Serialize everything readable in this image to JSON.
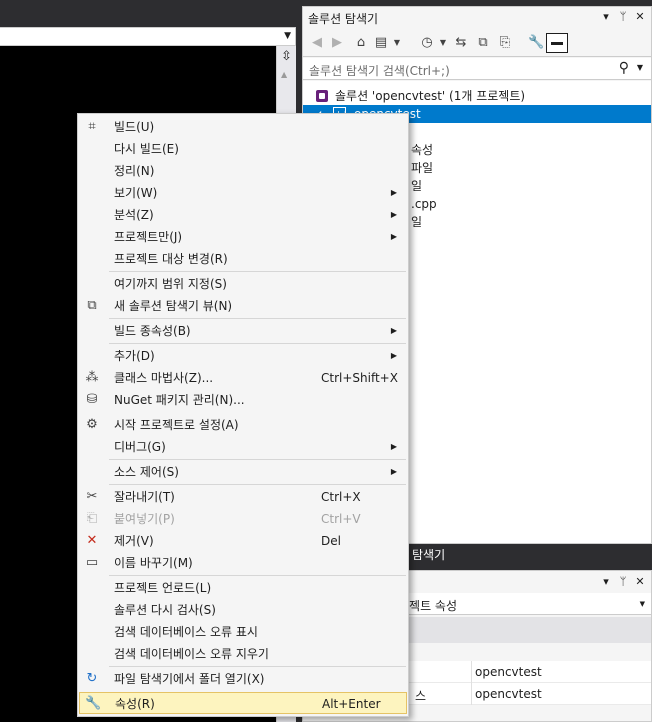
{
  "solution_explorer": {
    "title": "솔루션 탐색기",
    "title_buttons": {
      "dropdown": "▾",
      "pin": "ᛘ",
      "close": "✕"
    },
    "search_placeholder": "솔루션 탐색기 검색(Ctrl+;)",
    "tree": [
      {
        "label": "솔루션 'opencvtest' (1개 프로젝트)"
      },
      {
        "label": "opencvtest",
        "selected": true
      },
      {
        "label": "속성"
      },
      {
        "label": "파일"
      },
      {
        "label": "일"
      },
      {
        "label": ".cpp"
      },
      {
        "label": "일"
      }
    ],
    "bottom_tab": "탐색기"
  },
  "properties": {
    "title_buttons": {
      "dropdown": "▾",
      "pin": "ᛘ",
      "close": "✕"
    },
    "dropdown_value": "로젝트 속성",
    "rows": [
      {
        "name": "",
        "value": "opencvtest"
      },
      {
        "name": "스",
        "value": "opencvtest"
      }
    ]
  },
  "context_menu": {
    "items": [
      {
        "label": "빌드(U)",
        "icon": "build-icon"
      },
      {
        "label": "다시 빌드(E)"
      },
      {
        "label": "정리(N)"
      },
      {
        "label": "보기(W)",
        "submenu": true
      },
      {
        "label": "분석(Z)",
        "submenu": true
      },
      {
        "label": "프로젝트만(J)",
        "submenu": true
      },
      {
        "label": "프로젝트 대상 변경(R)"
      },
      {
        "label": "여기까지 범위 지정(S)"
      },
      {
        "label": "새 솔루션 탐색기 뷰(N)",
        "icon": "new-view-icon"
      },
      {
        "label": "빌드 종속성(B)",
        "submenu": true
      },
      {
        "label": "추가(D)",
        "submenu": true
      },
      {
        "label": "클래스 마법사(Z)...",
        "shortcut": "Ctrl+Shift+X",
        "icon": "class-wizard-icon"
      },
      {
        "label": "NuGet 패키지 관리(N)...",
        "icon": "nuget-icon"
      },
      {
        "label": "시작 프로젝트로 설정(A)",
        "icon": "gear-icon"
      },
      {
        "label": "디버그(G)",
        "submenu": true
      },
      {
        "label": "소스 제어(S)",
        "submenu": true
      },
      {
        "label": "잘라내기(T)",
        "shortcut": "Ctrl+X",
        "icon": "scissors-icon"
      },
      {
        "label": "붙여넣기(P)",
        "shortcut": "Ctrl+V",
        "icon": "paste-icon",
        "disabled": true
      },
      {
        "label": "제거(V)",
        "shortcut": "Del",
        "icon": "delete-icon"
      },
      {
        "label": "이름 바꾸기(M)",
        "icon": "rename-icon"
      },
      {
        "label": "프로젝트 언로드(L)"
      },
      {
        "label": "솔루션 다시 검사(S)"
      },
      {
        "label": "검색 데이터베이스 오류 표시"
      },
      {
        "label": "검색 데이터베이스 오류 지우기"
      },
      {
        "label": "파일 탐색기에서 폴더 열기(X)",
        "icon": "refresh-folder-icon"
      },
      {
        "label": "속성(R)",
        "shortcut": "Alt+Enter",
        "icon": "wrench-icon",
        "highlighted": true
      }
    ]
  }
}
